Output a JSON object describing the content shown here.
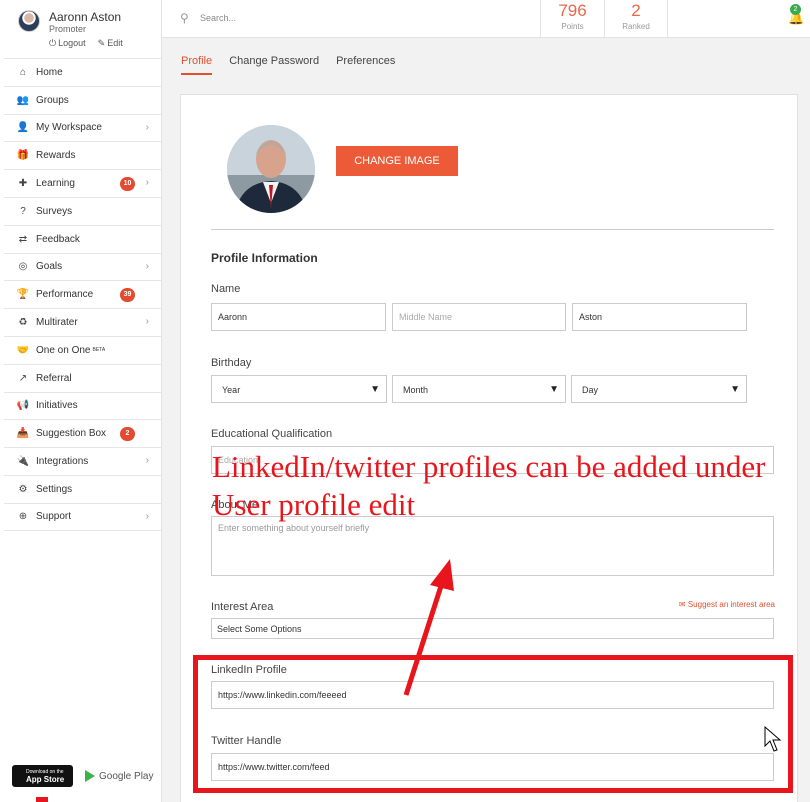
{
  "user": {
    "name": "Aaronn Aston",
    "role": "Promoter",
    "logout": "Logout",
    "edit": "Edit"
  },
  "nav": [
    {
      "label": "Home",
      "icon": "home-icon",
      "glyph": "⌂"
    },
    {
      "label": "Groups",
      "icon": "groups-icon",
      "glyph": "👥"
    },
    {
      "label": "My Workspace",
      "icon": "user-icon",
      "glyph": "👤",
      "chevron": true
    },
    {
      "label": "Rewards",
      "icon": "gift-icon",
      "glyph": "🎁"
    },
    {
      "label": "Learning",
      "icon": "puzzle-icon",
      "glyph": "✚",
      "badge": "10",
      "chevron": true
    },
    {
      "label": "Surveys",
      "icon": "question-icon",
      "glyph": "?"
    },
    {
      "label": "Feedback",
      "icon": "exchange-icon",
      "glyph": "⇄"
    },
    {
      "label": "Goals",
      "icon": "target-icon",
      "glyph": "◎",
      "chevron": true
    },
    {
      "label": "Performance",
      "icon": "trophy-icon",
      "glyph": "🏆",
      "badge": "39"
    },
    {
      "label": "Multirater",
      "icon": "recycle-icon",
      "glyph": "♻",
      "chevron": true
    },
    {
      "label": "One on One",
      "sup": "BETA",
      "icon": "handshake-icon",
      "glyph": "🤝"
    },
    {
      "label": "Referral",
      "icon": "share-icon",
      "glyph": "↗"
    },
    {
      "label": "Initiatives",
      "icon": "bullhorn-icon",
      "glyph": "📢"
    },
    {
      "label": "Suggestion Box",
      "icon": "inbox-icon",
      "glyph": "📥",
      "badge": "2"
    },
    {
      "label": "Integrations",
      "icon": "plug-icon",
      "glyph": "🔌",
      "chevron": true
    },
    {
      "label": "Settings",
      "icon": "gear-icon",
      "glyph": "⚙"
    },
    {
      "label": "Support",
      "icon": "lifebuoy-icon",
      "glyph": "⊕",
      "chevron": true
    }
  ],
  "store": {
    "appstore_small": "Download on the",
    "appstore": "App Store",
    "gplay": "Google Play"
  },
  "search": {
    "placeholder": "Search..."
  },
  "stats": {
    "points": "796",
    "points_label": "Points",
    "ranked": "2",
    "ranked_label": "Ranked"
  },
  "notifications": {
    "count": "2"
  },
  "tabs": [
    "Profile",
    "Change Password",
    "Preferences"
  ],
  "profile": {
    "change_image": "CHANGE IMAGE",
    "section_title": "Profile Information",
    "name_label": "Name",
    "first_name": "Aaronn",
    "middle_placeholder": "Middle Name",
    "last_name": "Aston",
    "birthday_label": "Birthday",
    "year": "Year",
    "month": "Month",
    "day": "Day",
    "education_label": "Educational Qualification",
    "education_placeholder": "Education",
    "about_label": "About Me",
    "about_placeholder": "Enter something about yourself briefly",
    "interest_label": "Interest Area",
    "interest_value": "Select Some Options",
    "suggest_link": "Suggest an interest area",
    "linkedin_label": "LinkedIn Profile",
    "linkedin_value": "https://www.linkedin.com/feeeed",
    "twitter_label": "Twitter Handle",
    "twitter_value": "https://www.twitter.com/feed"
  },
  "annotation": {
    "text": "LinkedIn/twitter profiles can be added under User profile edit",
    "color": "#e8151c"
  },
  "colors": {
    "accent": "#ec5a37",
    "badge": "#e24b2f",
    "bell_badge": "#3aaa4f"
  }
}
